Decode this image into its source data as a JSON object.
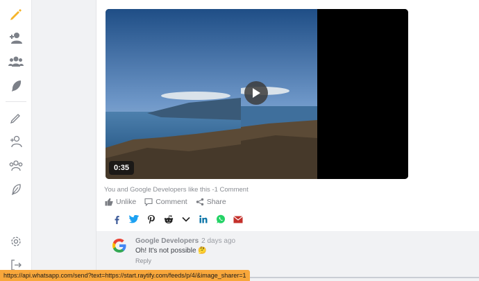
{
  "sidebar": {
    "icons": [
      "pencil-filled-icon",
      "user-add-filled-icon",
      "users-filled-icon",
      "feather-filled-icon",
      "pencil-outline-icon",
      "user-add-outline-icon",
      "users-outline-icon",
      "feather-outline-icon",
      "gear-icon",
      "logout-icon"
    ],
    "accent": "#f5b42a"
  },
  "post": {
    "video": {
      "duration": "0:35"
    },
    "likes_text": "You and Google Developers like this -1 Comment",
    "actions": {
      "unlike": "Unlike",
      "comment": "Comment",
      "share": "Share"
    },
    "share_targets": [
      "facebook-icon",
      "twitter-icon",
      "pinterest-icon",
      "reddit-icon",
      "more-chevron-icon",
      "linkedin-icon",
      "whatsapp-icon",
      "email-icon"
    ]
  },
  "comment": {
    "author": "Google Developers",
    "time": "2 days ago",
    "text": "Oh! It's not possible 🤔",
    "reply": "Reply"
  },
  "status_url": "https://api.whatsapp.com/send?text=https://start.raytify.com/feeds/p/4/&image_sharer=1"
}
